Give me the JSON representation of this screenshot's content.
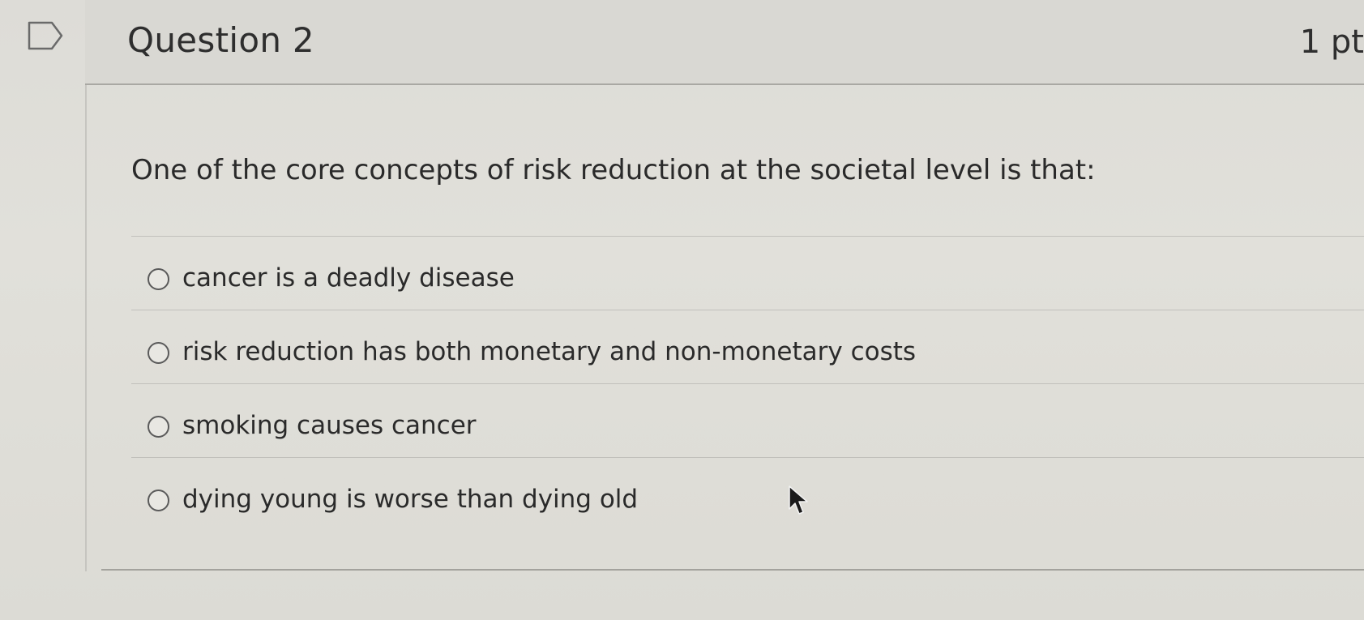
{
  "question": {
    "title": "Question 2",
    "points": "1 pt",
    "text": "One of the core concepts of risk reduction at the societal level is that:"
  },
  "answers": [
    {
      "label": "cancer is a deadly disease"
    },
    {
      "label": "risk reduction has both monetary and non-monetary costs"
    },
    {
      "label": "smoking causes cancer"
    },
    {
      "label": "dying young is worse than dying old"
    }
  ],
  "icons": {
    "flag": "flag-icon",
    "cursor": "mouse-pointer-icon",
    "radio": "radio-button-unselected"
  },
  "colors": {
    "background": "#dfded8",
    "text": "#2b2b2b",
    "divider": "#c1c0bb"
  }
}
